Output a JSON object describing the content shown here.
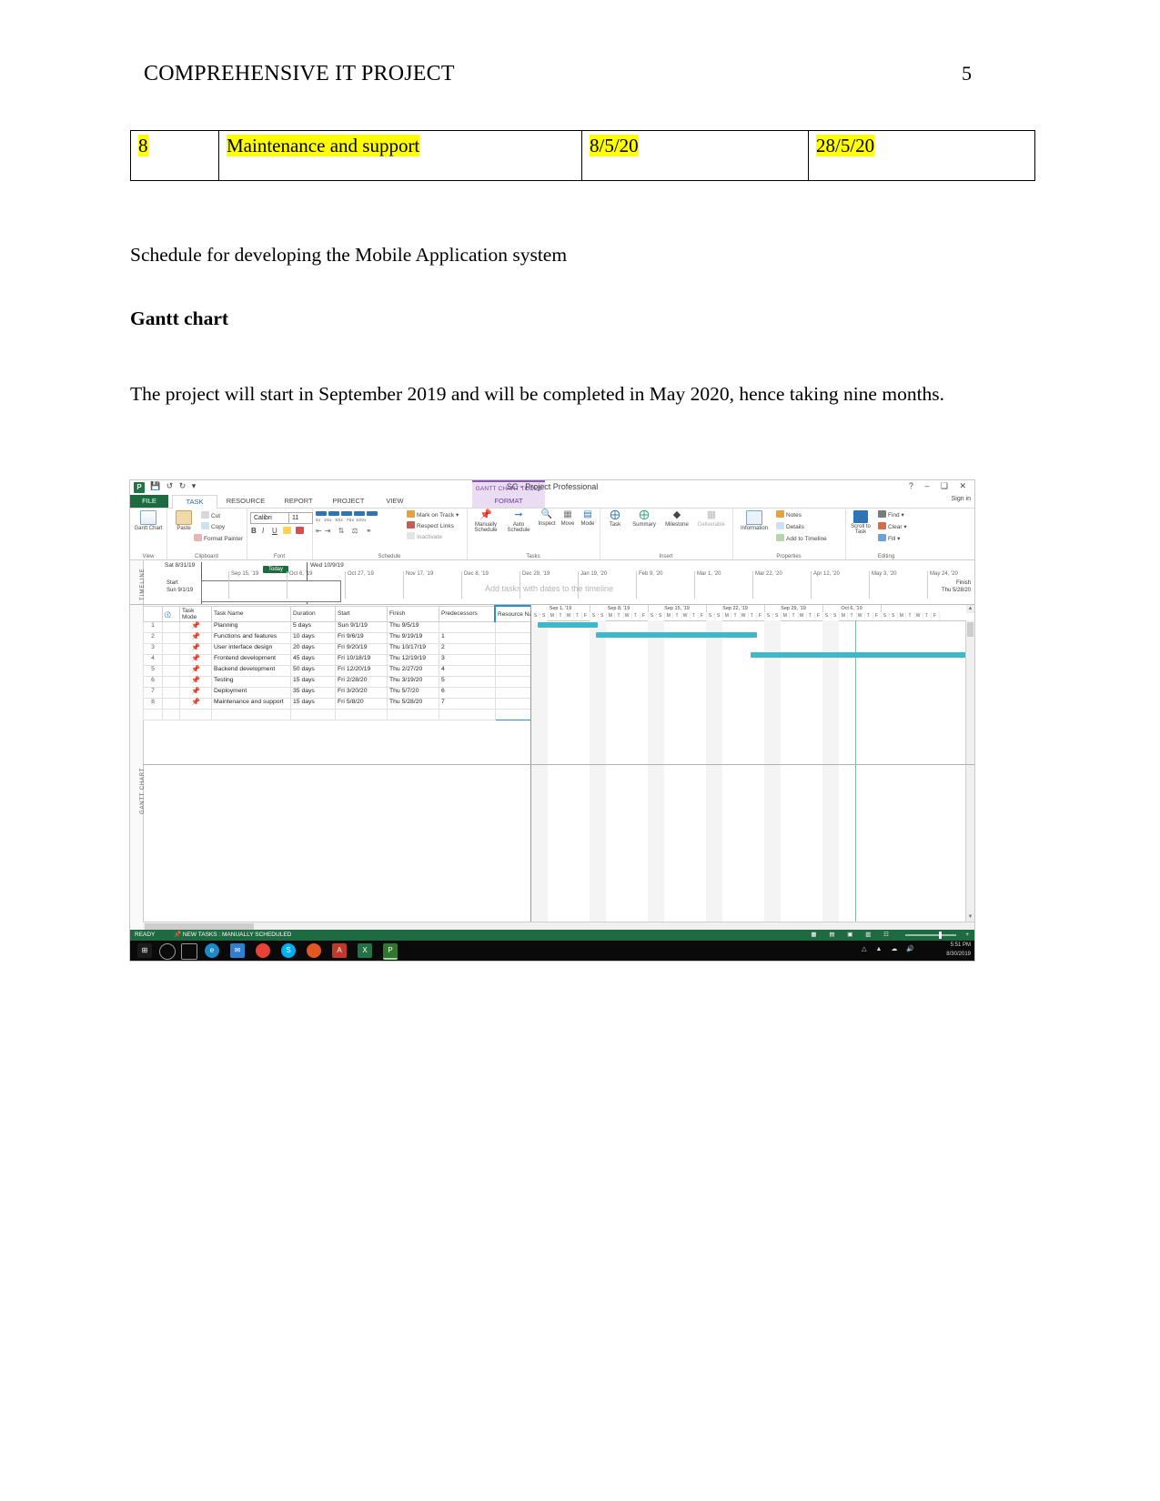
{
  "header": {
    "title": "COMPREHENSIVE IT PROJECT",
    "page_number": "5"
  },
  "table": {
    "columns": [
      "",
      "",
      "",
      ""
    ],
    "rows": [
      {
        "id": "8",
        "task": "Maintenance and support",
        "start": "8/5/20",
        "finish": "28/5/20"
      }
    ]
  },
  "body": {
    "schedule_line": "Schedule for developing the Mobile Application system",
    "gantt_heading": "Gantt chart",
    "intro_paragraph": "The project will start in September 2019 and will be completed in May 2020, hence taking nine months."
  },
  "screenshot": {
    "window_title": "SC - Project Professional",
    "quick_access": {
      "save": "save-icon",
      "undo": "undo-icon",
      "redo": "redo-icon",
      "custom": "customize-icon"
    },
    "window_buttons": {
      "help": "?",
      "minimize": "–",
      "restore": "❐",
      "close": "✕"
    },
    "contextual_tab": "GANTT CHART TOOLS",
    "signin": "Sign in",
    "tabs": [
      {
        "label": "FILE",
        "active": false
      },
      {
        "label": "TASK",
        "active": true
      },
      {
        "label": "RESOURCE",
        "active": false
      },
      {
        "label": "REPORT",
        "active": false
      },
      {
        "label": "PROJECT",
        "active": false
      },
      {
        "label": "VIEW",
        "active": false
      },
      {
        "label": "FORMAT",
        "active": false
      }
    ],
    "ribbon": {
      "groups": [
        "View",
        "Clipboard",
        "Font",
        "",
        "Schedule",
        "Tasks",
        "Insert",
        "Properties",
        "Editing"
      ],
      "view": {
        "button": "Gantt Chart"
      },
      "clipboard": {
        "paste": "Paste",
        "cut": "Cut",
        "copy": "Copy",
        "format_painter": "Format Painter"
      },
      "font": {
        "family": "Calibri",
        "size": "11",
        "bold": "B",
        "italic": "I",
        "underline": "U"
      },
      "schedule": {
        "percents": [
          "0x",
          "25x",
          "50x",
          "75x",
          "100x"
        ],
        "mark_on_track": "Mark on Track",
        "respect_links": "Respect Links",
        "inactivate": "Inactivate"
      },
      "tasks": {
        "manually_schedule": "Manually Schedule",
        "auto_schedule": "Auto Schedule",
        "inspect": "Inspect",
        "move": "Move",
        "mode": "Mode"
      },
      "insert": {
        "task": "Task",
        "summary": "Summary",
        "milestone": "Milestone",
        "deliverable": "Deliverable"
      },
      "properties": {
        "information": "Information",
        "notes": "Notes",
        "details": "Details",
        "add_to_timeline": "Add to Timeline"
      },
      "editing": {
        "scroll_to_task": "Scroll to Task",
        "find": "Find",
        "clear": "Clear",
        "fill": "Fill"
      }
    },
    "timeline": {
      "side_label": "TIMELINE",
      "range_start": "Sat 8/31/19",
      "range_end": "Wed 10/9/19",
      "today_label": "Today",
      "start_label": "Start",
      "start_date": "Sun 9/1/19",
      "finish_label": "Finish",
      "finish_date": "Thu 5/28/20",
      "placeholder": "Add tasks with dates to the timeline",
      "ticks": [
        "Sep 15, '19",
        "Oct 6, '19",
        "Oct 27, '19",
        "Nov 17, '19",
        "Dec 8, '19",
        "Dec 29, '19",
        "Jan 19, '20",
        "Feb 9, '20",
        "Mar 1, '20",
        "Mar 22, '20",
        "Apr 12, '20",
        "May 3, '20",
        "May 24, '20"
      ]
    },
    "grid": {
      "side_label": "GANTT CHART",
      "columns": [
        "",
        "i",
        "Task Mode",
        "Task Name",
        "Duration",
        "Start",
        "Finish",
        "Predecessors",
        "Resource Names"
      ],
      "rows": [
        {
          "id": "1",
          "mode": "manual-pin",
          "name": "Planning",
          "duration": "5 days",
          "start": "Sun 9/1/19",
          "finish": "Thu 9/5/19",
          "predecessors": "",
          "resources": ""
        },
        {
          "id": "2",
          "mode": "manual-pin",
          "name": "Functions and features",
          "duration": "10 days",
          "start": "Fri 9/6/19",
          "finish": "Thu 9/19/19",
          "predecessors": "1",
          "resources": ""
        },
        {
          "id": "3",
          "mode": "manual-pin",
          "name": "User interface design",
          "duration": "20 days",
          "start": "Fri 9/20/19",
          "finish": "Thu 10/17/19",
          "predecessors": "2",
          "resources": ""
        },
        {
          "id": "4",
          "mode": "manual-pin",
          "name": "Frontend development",
          "duration": "45 days",
          "start": "Fri 10/18/19",
          "finish": "Thu 12/19/19",
          "predecessors": "3",
          "resources": ""
        },
        {
          "id": "5",
          "mode": "manual-pin",
          "name": "Backend development",
          "duration": "50 days",
          "start": "Fri 12/20/19",
          "finish": "Thu 2/27/20",
          "predecessors": "4",
          "resources": ""
        },
        {
          "id": "6",
          "mode": "manual-pin",
          "name": "Testing",
          "duration": "15 days",
          "start": "Fri 2/28/20",
          "finish": "Thu 3/19/20",
          "predecessors": "5",
          "resources": ""
        },
        {
          "id": "7",
          "mode": "manual-pin",
          "name": "Deployment",
          "duration": "35 days",
          "start": "Fri 3/20/20",
          "finish": "Thu 5/7/20",
          "predecessors": "6",
          "resources": ""
        },
        {
          "id": "8",
          "mode": "manual-pin",
          "name": "Maintenance and support",
          "duration": "15 days",
          "start": "Fri 5/8/20",
          "finish": "Thu 5/28/20",
          "predecessors": "7",
          "resources": ""
        }
      ]
    },
    "gantt_scale": {
      "weeks": [
        "Sep 1, '19",
        "Sep 8, '19",
        "Sep 15, '19",
        "Sep 22, '19",
        "Sep 29, '19",
        "Oct 6, '19"
      ],
      "days": [
        "S",
        "S",
        "M",
        "T",
        "W",
        "T",
        "F"
      ]
    },
    "chart_bars": [
      {
        "task": "Planning",
        "left_pct": 1.5,
        "width_pct": 13.5,
        "color": "#3fb8cc"
      },
      {
        "task": "Functions and features",
        "left_pct": 14.5,
        "width_pct": 36.5,
        "color": "#3fb8cc"
      },
      {
        "task": "User interface design",
        "left_pct": 49.5,
        "width_pct": 50.0,
        "color": "#3fb8cc"
      }
    ],
    "status_bar": {
      "ready": "READY",
      "new_tasks": "NEW TASKS : MANUALLY SCHEDULED",
      "views": "view-icons",
      "zoom": "zoom-slider"
    },
    "taskbar": {
      "start": "start-icon",
      "apps": [
        "cortana-icon",
        "task-view-icon",
        "edge-icon",
        "mail-icon",
        "chrome-icon",
        "skype-icon",
        "firefox-icon",
        "pdf-icon",
        "excel-icon",
        "project-icon"
      ],
      "time": "5:51 PM",
      "date": "8/30/2019"
    }
  }
}
